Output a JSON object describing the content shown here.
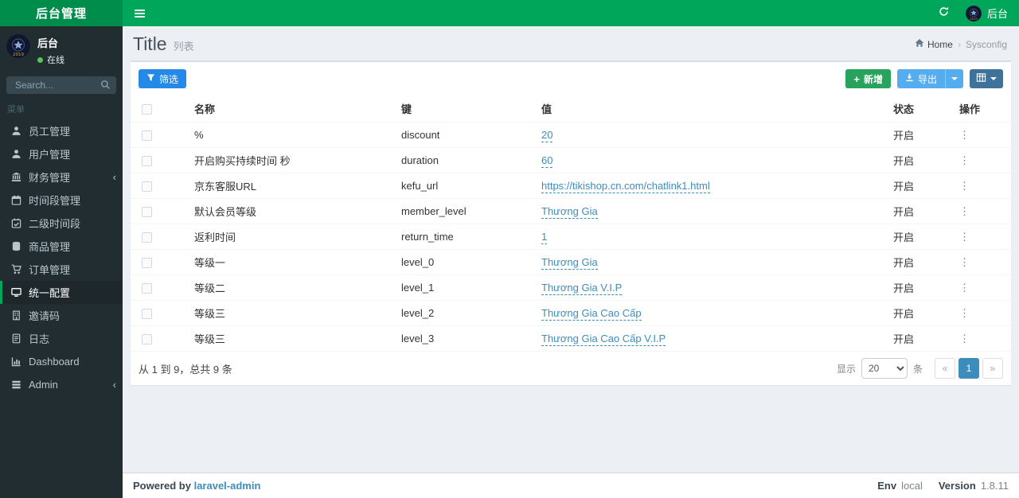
{
  "colors": {
    "navbar_green": "#00a65a",
    "logo_green": "#008d4c",
    "sidebar_dark": "#222d32",
    "sidebar_active_bg": "#1e282c",
    "sidebar_text": "#b8c7ce",
    "content_bg": "#ecf0f5",
    "link_blue": "#3c8dbc",
    "filter_blue": "#2589e8",
    "export_blue": "#55acee",
    "grid_blue": "#3f729b",
    "success_green": "#27a35c",
    "pager_active": "#3c8dbc"
  },
  "header": {
    "brand": "后台管理",
    "user_name": "后台"
  },
  "sidebar": {
    "user": {
      "name": "后台",
      "status": "在线"
    },
    "search_placeholder": "Search...",
    "section_label": "菜单",
    "items": [
      {
        "id": "staff",
        "label": "员工管理",
        "icon": "user",
        "active": false,
        "has_children": false
      },
      {
        "id": "users",
        "label": "用户管理",
        "icon": "user",
        "active": false,
        "has_children": false
      },
      {
        "id": "finance",
        "label": "财务管理",
        "icon": "bank",
        "active": false,
        "has_children": true
      },
      {
        "id": "timeslot",
        "label": "时间段管理",
        "icon": "calendar",
        "active": false,
        "has_children": false
      },
      {
        "id": "subslot",
        "label": "二级时间段",
        "icon": "calendar-check",
        "active": false,
        "has_children": false
      },
      {
        "id": "goods",
        "label": "商品管理",
        "icon": "database",
        "active": false,
        "has_children": false
      },
      {
        "id": "orders",
        "label": "订单管理",
        "icon": "cart",
        "active": false,
        "has_children": false
      },
      {
        "id": "sysconfig",
        "label": "统一配置",
        "icon": "desktop",
        "active": true,
        "has_children": false
      },
      {
        "id": "invite",
        "label": "邀请码",
        "icon": "building",
        "active": false,
        "has_children": false
      },
      {
        "id": "logs",
        "label": "日志",
        "icon": "file",
        "active": false,
        "has_children": false
      },
      {
        "id": "dashboard",
        "label": "Dashboard",
        "icon": "bar-chart",
        "active": false,
        "has_children": false
      },
      {
        "id": "admin",
        "label": "Admin",
        "icon": "tasks",
        "active": false,
        "has_children": true
      }
    ]
  },
  "page": {
    "title": "Title",
    "subtitle": "列表",
    "breadcrumb": {
      "home": "Home",
      "current": "Sysconfig"
    }
  },
  "toolbar": {
    "filter_label": "筛选",
    "new_label": "新增",
    "export_label": "导出"
  },
  "table": {
    "columns": [
      "名称",
      "键",
      "值",
      "状态",
      "操作"
    ],
    "rows": [
      {
        "name": "%",
        "key": "discount",
        "value": "20",
        "status": "开启"
      },
      {
        "name": "开启购买持续时间 秒",
        "key": "duration",
        "value": "60",
        "status": "开启"
      },
      {
        "name": "京东客服URL",
        "key": "kefu_url",
        "value": "https://tikishop.cn.com/chatlink1.html",
        "status": "开启"
      },
      {
        "name": "默认会员等级",
        "key": "member_level",
        "value": "Thương Gia",
        "status": "开启"
      },
      {
        "name": "返利时间",
        "key": "return_time",
        "value": "1",
        "status": "开启"
      },
      {
        "name": "等级一",
        "key": "level_0",
        "value": "Thương Gia",
        "status": "开启"
      },
      {
        "name": "等级二",
        "key": "level_1",
        "value": "Thương Gia V.I.P",
        "status": "开启"
      },
      {
        "name": "等级三",
        "key": "level_2",
        "value": "Thương Gia Cao Cấp",
        "status": "开启"
      },
      {
        "name": "等级三",
        "key": "level_3",
        "value": "Thương Gia Cao Cấp V.I.P",
        "status": "开启"
      }
    ]
  },
  "table_footer": {
    "summary": "从 1 到 9，总共 9 条",
    "show_label": "显示",
    "per_page": "20",
    "unit_label": "条",
    "pager": [
      "«",
      "1",
      "»"
    ]
  },
  "footer": {
    "powered_by": "Powered by",
    "brand_link": "laravel-admin",
    "env_label": "Env",
    "env_value": "local",
    "version_label": "Version",
    "version_value": "1.8.11"
  }
}
